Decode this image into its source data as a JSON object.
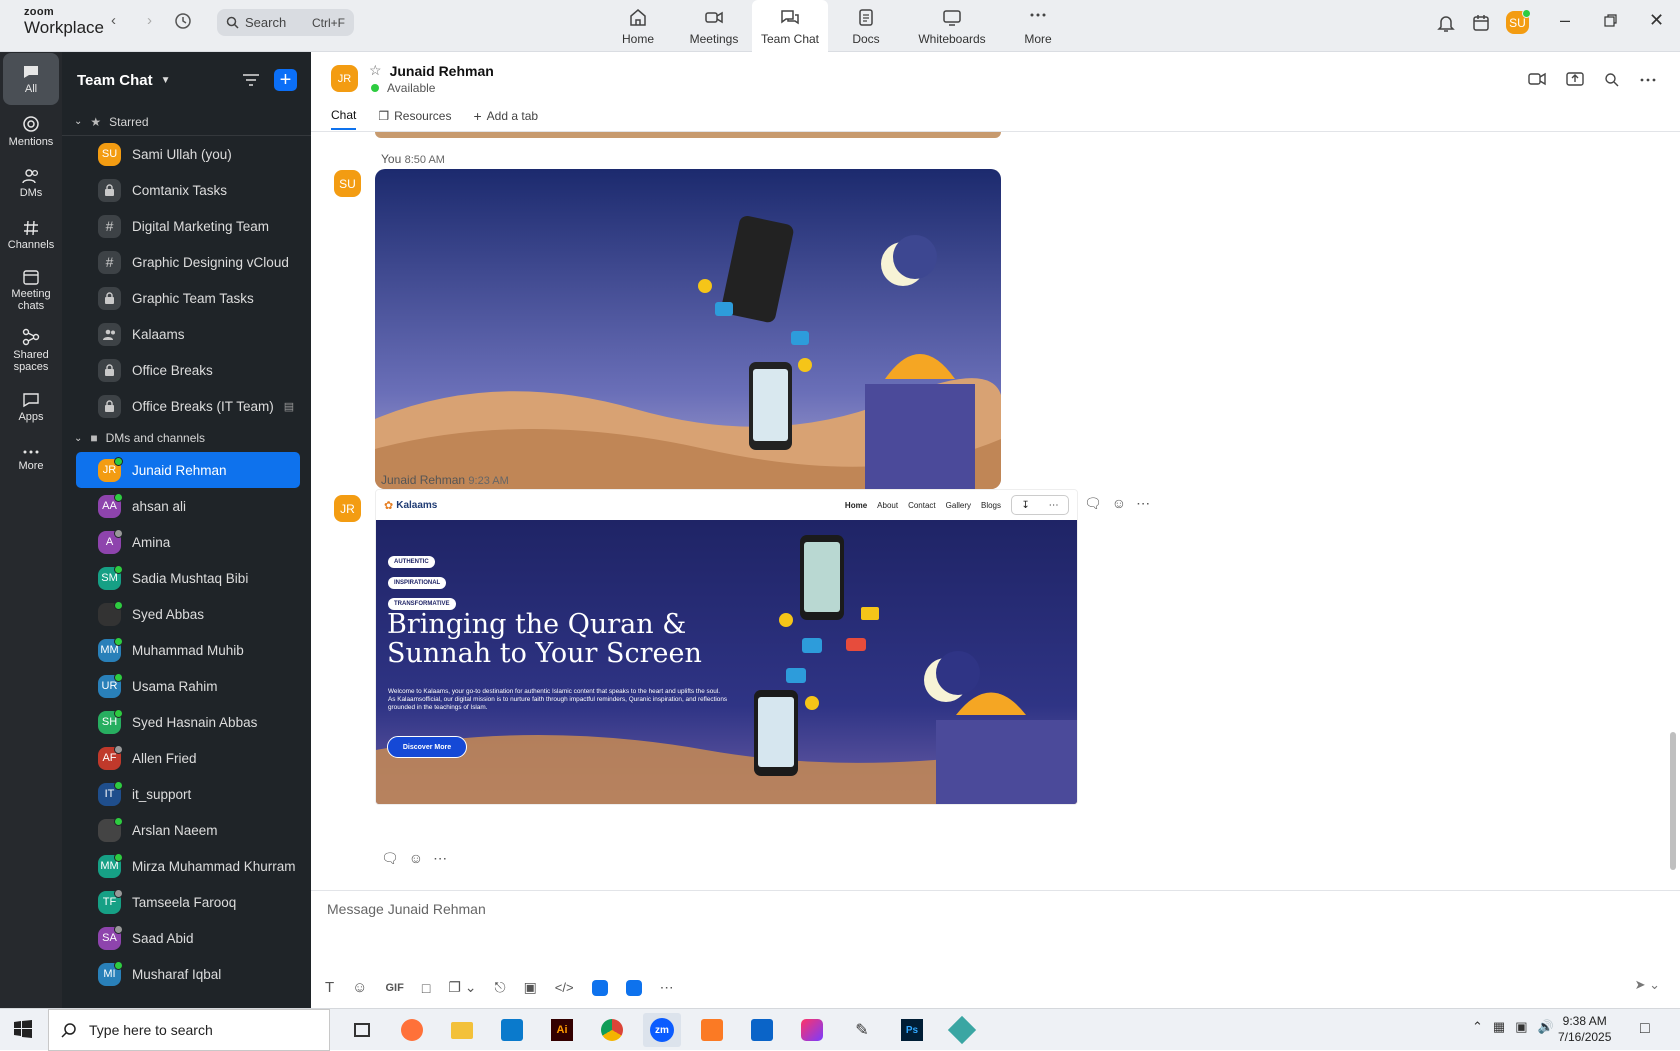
{
  "app": {
    "brand_small": "zoom",
    "brand_large": "Workplace"
  },
  "search": {
    "placeholder": "Search",
    "shortcut": "Ctrl+F"
  },
  "top_tabs": [
    {
      "label": "Home",
      "icon": "home-icon"
    },
    {
      "label": "Meetings",
      "icon": "video-camera-icon"
    },
    {
      "label": "Team Chat",
      "icon": "chat-bubbles-icon"
    },
    {
      "label": "Docs",
      "icon": "document-icon"
    },
    {
      "label": "Whiteboards",
      "icon": "whiteboard-icon"
    },
    {
      "label": "More",
      "icon": "ellipsis-icon"
    }
  ],
  "user": {
    "initials": "SU",
    "color": "#f39c12",
    "status_color": "#2ecc40"
  },
  "rail": [
    {
      "label": "All",
      "icon": "chat-icon"
    },
    {
      "label": "Mentions",
      "icon": "at-icon"
    },
    {
      "label": "DMs",
      "icon": "people-icon"
    },
    {
      "label": "Channels",
      "icon": "hash-icon"
    },
    {
      "label": "Meeting chats",
      "icon": "calendar-icon"
    },
    {
      "label": "Shared spaces",
      "icon": "share-icon"
    },
    {
      "label": "Apps",
      "icon": "apps-icon"
    },
    {
      "label": "More",
      "icon": "ellipsis-icon"
    }
  ],
  "sidebar": {
    "title": "Team Chat",
    "starred_label": "Starred",
    "starred": [
      {
        "label": "Sami Ullah (you)",
        "type": "avatar",
        "initials": "SU",
        "color": "#f39c12"
      },
      {
        "label": "Comtanix Tasks",
        "type": "lock"
      },
      {
        "label": "Digital Marketing Team",
        "type": "hash"
      },
      {
        "label": "Graphic Designing vCloud",
        "type": "hash"
      },
      {
        "label": "Graphic Team Tasks",
        "type": "lock"
      },
      {
        "label": "Kalaams",
        "type": "group"
      },
      {
        "label": "Office Breaks",
        "type": "lock"
      },
      {
        "label": "Office Breaks (IT Team)",
        "type": "lock"
      }
    ],
    "dms_label": "DMs and channels",
    "dms": [
      {
        "label": "Junaid Rehman",
        "initials": "JR",
        "color": "#f39c12",
        "status": "#2ecc40"
      },
      {
        "label": "ahsan ali",
        "initials": "AA",
        "color": "#8e44ad",
        "status": "#2ecc40"
      },
      {
        "label": "Amina",
        "initials": "A",
        "color": "#8e44ad",
        "status": "#999999"
      },
      {
        "label": "Sadia Mushtaq Bibi",
        "initials": "SM",
        "color": "#16a085",
        "status": "#2ecc40"
      },
      {
        "label": "Syed Abbas",
        "initials": "",
        "color": "#333333",
        "status": "#2ecc40"
      },
      {
        "label": "Muhammad Muhib",
        "initials": "MM",
        "color": "#2980b9",
        "status": "#2ecc40"
      },
      {
        "label": "Usama Rahim",
        "initials": "UR",
        "color": "#2980b9",
        "status": "#2ecc40"
      },
      {
        "label": "Syed Hasnain Abbas",
        "initials": "SH",
        "color": "#27ae60",
        "status": "#2ecc40"
      },
      {
        "label": "Allen Fried",
        "initials": "AF",
        "color": "#c0392b",
        "status": "#999999"
      },
      {
        "label": "it_support",
        "initials": "IT",
        "color": "#1f4e8c",
        "status": "#2ecc40"
      },
      {
        "label": "Arslan Naeem",
        "initials": "",
        "color": "#444444",
        "status": "#2ecc40"
      },
      {
        "label": "Mirza Muhammad Khurram",
        "initials": "MM",
        "color": "#16a085",
        "status": "#2ecc40"
      },
      {
        "label": "Tamseela Farooq",
        "initials": "TF",
        "color": "#16a085",
        "status": "#999999"
      },
      {
        "label": "Saad Abid",
        "initials": "SA",
        "color": "#8e44ad",
        "status": "#999999"
      },
      {
        "label": "Musharaf Iqbal",
        "initials": "MI",
        "color": "#2980b9",
        "status": "#2ecc40"
      }
    ]
  },
  "chat": {
    "contact": "Junaid Rehman",
    "initials": "JR",
    "status": "Available",
    "tabs": [
      "Chat",
      "Resources",
      "Add a tab"
    ],
    "messages": [
      {
        "sender": "You",
        "time": "8:50 AM",
        "initials": "SU",
        "color": "#f39c12"
      },
      {
        "sender": "Junaid Rehman",
        "time": "9:23 AM",
        "initials": "JR",
        "color": "#f39c12"
      }
    ],
    "banner": {
      "logo": "Kalaams",
      "nav": [
        "Home",
        "About",
        "Contact",
        "Gallery",
        "Blogs"
      ],
      "pills": [
        "AUTHENTIC",
        "INSPIRATIONAL",
        "TRANSFORMATIVE"
      ],
      "headline_1": "Bringing the Quran &",
      "headline_2": "Sunnah to Your Screen",
      "body": "Welcome to Kalaams, your go-to destination for authentic Islamic content that speaks to the heart and uplifts the soul. As Kalaamsofficial, our digital mission is to nurture faith through impactful reminders, Quranic inspiration, and reflections grounded in the teachings of Islam.",
      "cta": "Discover More"
    },
    "compose_placeholder": "Message Junaid Rehman"
  },
  "taskbar": {
    "search": "Type here to search",
    "time": "9:38 AM",
    "date": "7/16/2025"
  }
}
